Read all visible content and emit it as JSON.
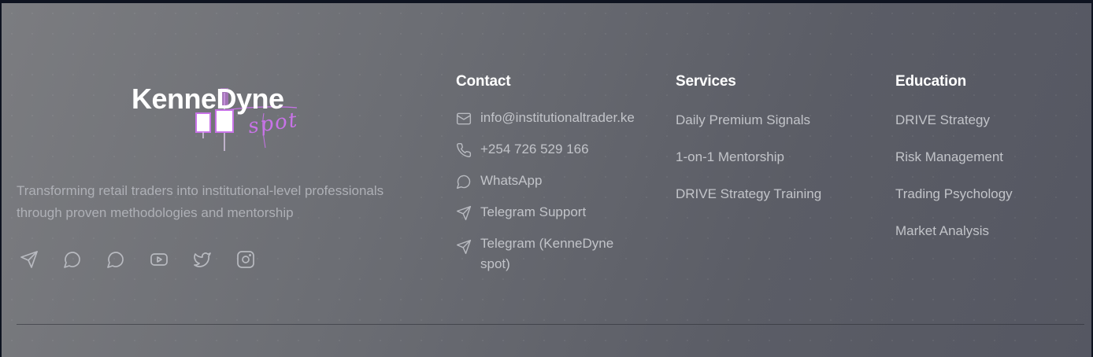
{
  "brand": {
    "logo_text": "KenneDyne",
    "logo_script": "spot",
    "tagline": "Transforming retail traders into institutional-level professionals through proven methodologies and mentorship",
    "socials": [
      {
        "icon": "telegram-icon"
      },
      {
        "icon": "whatsapp-icon"
      },
      {
        "icon": "message-circle-icon"
      },
      {
        "icon": "youtube-icon"
      },
      {
        "icon": "twitter-icon"
      },
      {
        "icon": "instagram-icon"
      }
    ]
  },
  "contact": {
    "title": "Contact",
    "items": [
      {
        "icon": "mail-icon",
        "text": "info@institutionaltrader.ke"
      },
      {
        "icon": "phone-icon",
        "text": "+254 726 529 166"
      },
      {
        "icon": "whatsapp-icon",
        "text": "WhatsApp"
      },
      {
        "icon": "telegram-icon",
        "text": "Telegram Support"
      },
      {
        "icon": "telegram-icon",
        "text": "Telegram (KenneDyne spot)"
      }
    ]
  },
  "services": {
    "title": "Services",
    "items": [
      "Daily Premium Signals",
      "1-on-1 Mentorship",
      "DRIVE Strategy Training"
    ]
  },
  "education": {
    "title": "Education",
    "items": [
      "DRIVE Strategy",
      "Risk Management",
      "Trading Psychology",
      "Market Analysis"
    ]
  },
  "colors": {
    "heading": "#ffffff",
    "link": "#c2c4c9",
    "muted": "#aeb0b6",
    "logo_accent": "#c873e8"
  }
}
